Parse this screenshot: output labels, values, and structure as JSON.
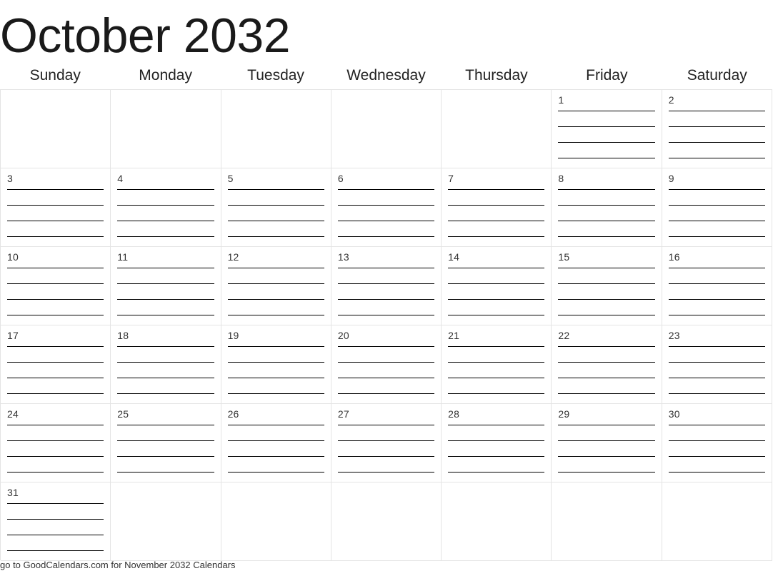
{
  "title": "October 2032",
  "month_name": "October",
  "year": "2032",
  "weekdays": [
    "Sunday",
    "Monday",
    "Tuesday",
    "Wednesday",
    "Thursday",
    "Friday",
    "Saturday"
  ],
  "lines_per_day": 4,
  "colors": {
    "page_background": "#ffffff",
    "title_text": "#1a1a1a",
    "weekday_text": "#222222",
    "date_text": "#333333",
    "grid_border": "#e4e4e4",
    "write_line": "#000000",
    "footer_text": "#333333"
  },
  "weeks": [
    [
      {
        "date": "",
        "lines": 0
      },
      {
        "date": "",
        "lines": 0
      },
      {
        "date": "",
        "lines": 0
      },
      {
        "date": "",
        "lines": 0
      },
      {
        "date": "",
        "lines": 0
      },
      {
        "date": "1",
        "lines": 4
      },
      {
        "date": "2",
        "lines": 4
      }
    ],
    [
      {
        "date": "3",
        "lines": 4
      },
      {
        "date": "4",
        "lines": 4
      },
      {
        "date": "5",
        "lines": 4
      },
      {
        "date": "6",
        "lines": 4
      },
      {
        "date": "7",
        "lines": 4
      },
      {
        "date": "8",
        "lines": 4
      },
      {
        "date": "9",
        "lines": 4
      }
    ],
    [
      {
        "date": "10",
        "lines": 4
      },
      {
        "date": "11",
        "lines": 4
      },
      {
        "date": "12",
        "lines": 4
      },
      {
        "date": "13",
        "lines": 4
      },
      {
        "date": "14",
        "lines": 4
      },
      {
        "date": "15",
        "lines": 4
      },
      {
        "date": "16",
        "lines": 4
      }
    ],
    [
      {
        "date": "17",
        "lines": 4
      },
      {
        "date": "18",
        "lines": 4
      },
      {
        "date": "19",
        "lines": 4
      },
      {
        "date": "20",
        "lines": 4
      },
      {
        "date": "21",
        "lines": 4
      },
      {
        "date": "22",
        "lines": 4
      },
      {
        "date": "23",
        "lines": 4
      }
    ],
    [
      {
        "date": "24",
        "lines": 4
      },
      {
        "date": "25",
        "lines": 4
      },
      {
        "date": "26",
        "lines": 4
      },
      {
        "date": "27",
        "lines": 4
      },
      {
        "date": "28",
        "lines": 4
      },
      {
        "date": "29",
        "lines": 4
      },
      {
        "date": "30",
        "lines": 4
      }
    ],
    [
      {
        "date": "31",
        "lines": 4
      },
      {
        "date": "",
        "lines": 0
      },
      {
        "date": "",
        "lines": 0
      },
      {
        "date": "",
        "lines": 0
      },
      {
        "date": "",
        "lines": 0
      },
      {
        "date": "",
        "lines": 0
      },
      {
        "date": "",
        "lines": 0
      }
    ]
  ],
  "footer": {
    "note": "go to GoodCalendars.com for November 2032 Calendars"
  }
}
